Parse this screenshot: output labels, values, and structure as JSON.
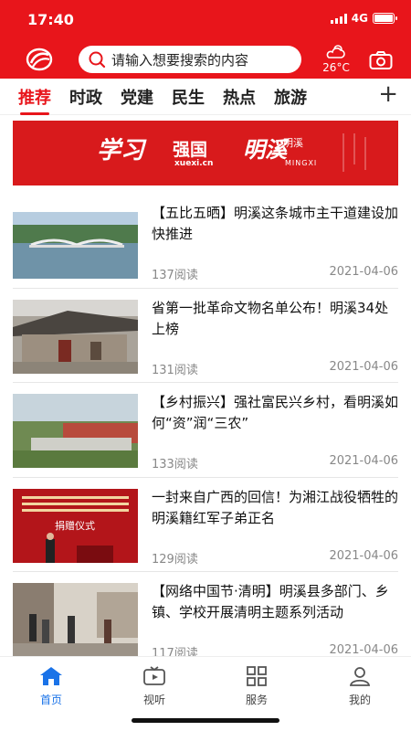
{
  "status": {
    "time": "17:40",
    "network": "4G",
    "battery_level": 1.0
  },
  "header": {
    "search_placeholder": "请输入想要搜索的内容",
    "weather_temp": "26°C",
    "colors": {
      "brand": "#e8151b"
    }
  },
  "tabs": [
    {
      "label": "推荐",
      "active": true
    },
    {
      "label": "时政",
      "active": false
    },
    {
      "label": "党建",
      "active": false
    },
    {
      "label": "民生",
      "active": false
    },
    {
      "label": "热点",
      "active": false
    },
    {
      "label": "旅游",
      "active": false
    }
  ],
  "tab_add_icon": "plus-icon",
  "banner": {
    "xuexi": "学习",
    "qiangguo": "强国",
    "xuexi_url": "xuexi.cn",
    "mingxi_art": "明溪",
    "mingxi_cn": "明溪",
    "mingxi_en": "MINGXI"
  },
  "news": [
    {
      "title": "【五比五晒】明溪这条城市主干道建设加快推进",
      "reads": "137阅读",
      "date": "2021-04-06"
    },
    {
      "title": "省第一批革命文物名单公布！明溪34处上榜",
      "reads": "131阅读",
      "date": "2021-04-06"
    },
    {
      "title": "【乡村振兴】强社富民兴乡村，看明溪如何“资”润“三农”",
      "reads": "133阅读",
      "date": "2021-04-06"
    },
    {
      "title": "一封来自广西的回信！为湘江战役牺牲的明溪籍红军子弟正名",
      "reads": "129阅读",
      "date": "2021-04-06"
    },
    {
      "title": "【网络中国节·清明】明溪县多部门、乡镇、学校开展清明主题系列活动",
      "reads": "117阅读",
      "date": "2021-04-06"
    }
  ],
  "thumb4_caption": "捐赠仪式",
  "bottom_nav": [
    {
      "label": "首页",
      "icon": "home-icon",
      "active": true
    },
    {
      "label": "视听",
      "icon": "tv-icon",
      "active": false
    },
    {
      "label": "服务",
      "icon": "grid-icon",
      "active": false
    },
    {
      "label": "我的",
      "icon": "user-icon",
      "active": false
    }
  ]
}
